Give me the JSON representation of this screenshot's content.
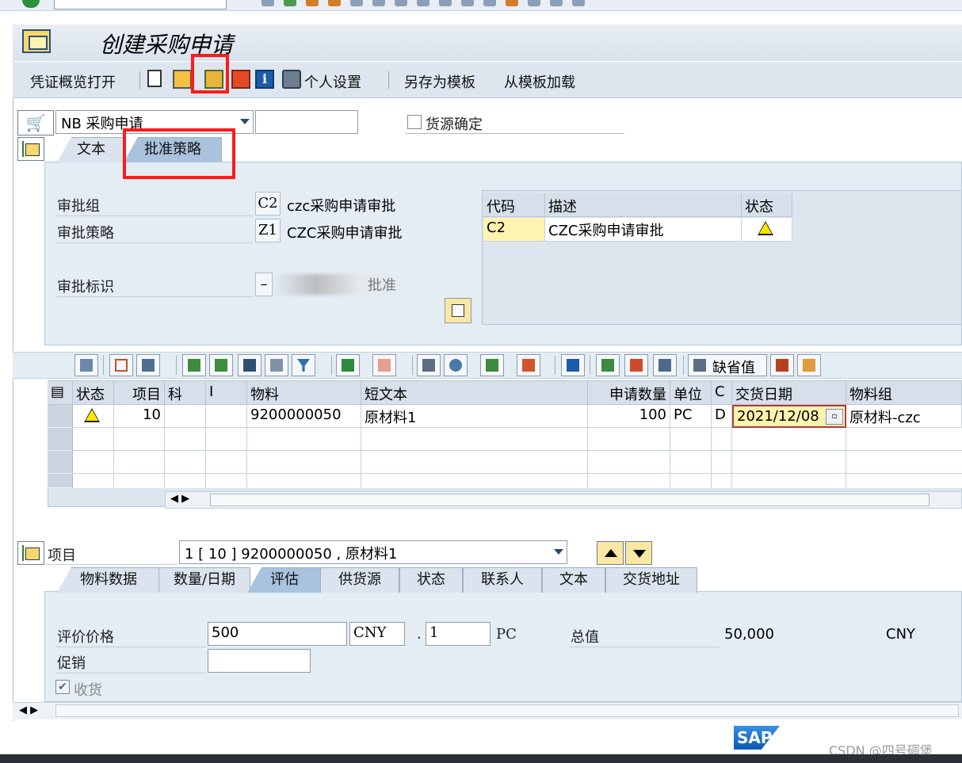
{
  "window": {
    "title": "创建采购申请"
  },
  "toolbar": {
    "doc_overview": "凭证概览打开",
    "personal_settings": "个人设置",
    "save_as_template": "另存为模板",
    "load_from_template": "从模板加载"
  },
  "header": {
    "doc_type_value": "NB 采购申请",
    "doc_number_value": "",
    "source_determination_label": "货源确定",
    "source_determination_checked": false,
    "tabs": [
      "文本",
      "批准策略"
    ],
    "active_tab": "批准策略",
    "approval_group_label": "审批组",
    "approval_group_code": "C2",
    "approval_group_desc": "czc采购申请审批",
    "approval_strategy_label": "审批策略",
    "approval_strategy_code": "Z1",
    "approval_strategy_desc": "CZC采购申请审批",
    "approval_indicator_label": "审批标识",
    "approval_indicator_code": "–",
    "approval_indicator_desc": "批准",
    "status_table": {
      "columns": [
        "代码",
        "描述",
        "状态"
      ],
      "rows": [
        {
          "code": "C2",
          "desc": "CZC采购申请审批",
          "status_icon": "warning-icon"
        }
      ]
    }
  },
  "items_grid": {
    "toolbar_buttons": [
      "details-icon",
      "copy-icon",
      "delete-icon",
      "align-top-icon",
      "filter-icon",
      "find-icon",
      "find-next-icon",
      "funnel-icon",
      "sum-icon",
      "subtotal-icon",
      "print-icon",
      "view-icon",
      "export-icon",
      "layout-icon",
      "info-icon",
      "upload-icon",
      "settings-icon",
      "hand-icon"
    ],
    "default_values_label": "缺省值",
    "columns": [
      "状态",
      "项目",
      "科",
      "I",
      "物料",
      "短文本",
      "申请数量",
      "单位",
      "C",
      "交货日期",
      "物料组"
    ],
    "rows": [
      {
        "status_icon": "warning-icon",
        "item": "10",
        "acct": "",
        "i": "",
        "material": "9200000050",
        "short_text": "原材料1",
        "qty": "100",
        "unit": "PC",
        "c": "D",
        "delivery_date": "2021/12/08",
        "material_group": "原材料-czc"
      }
    ]
  },
  "item_detail": {
    "item_label": "项目",
    "item_select_value": "1 [ 10 ] 9200000050 , 原材料1",
    "tabs": [
      "物料数据",
      "数量/日期",
      "评估",
      "供货源",
      "状态",
      "联系人",
      "文本",
      "交货地址"
    ],
    "active_tab": "评估",
    "valuation_price_label": "评价价格",
    "valuation_price_value": "500",
    "currency_value": "CNY",
    "price_unit_sep": ".",
    "price_unit_value": "1",
    "price_unit_uom": "PC",
    "total_value_label": "总值",
    "total_value": "50,000",
    "total_currency": "CNY",
    "promotion_label": "促销",
    "promotion_value": "",
    "goods_receipt_label": "收货",
    "goods_receipt_checked": true
  },
  "footer": {
    "sap_logo": "SAP",
    "watermark": "CSDN @四号碉堡"
  },
  "colors": {
    "highlight_red": "#ff1a1a",
    "active_tab_blue": "#a9c3de",
    "yellow_cell": "#fff3b0",
    "warning_yellow": "#ffe600"
  }
}
